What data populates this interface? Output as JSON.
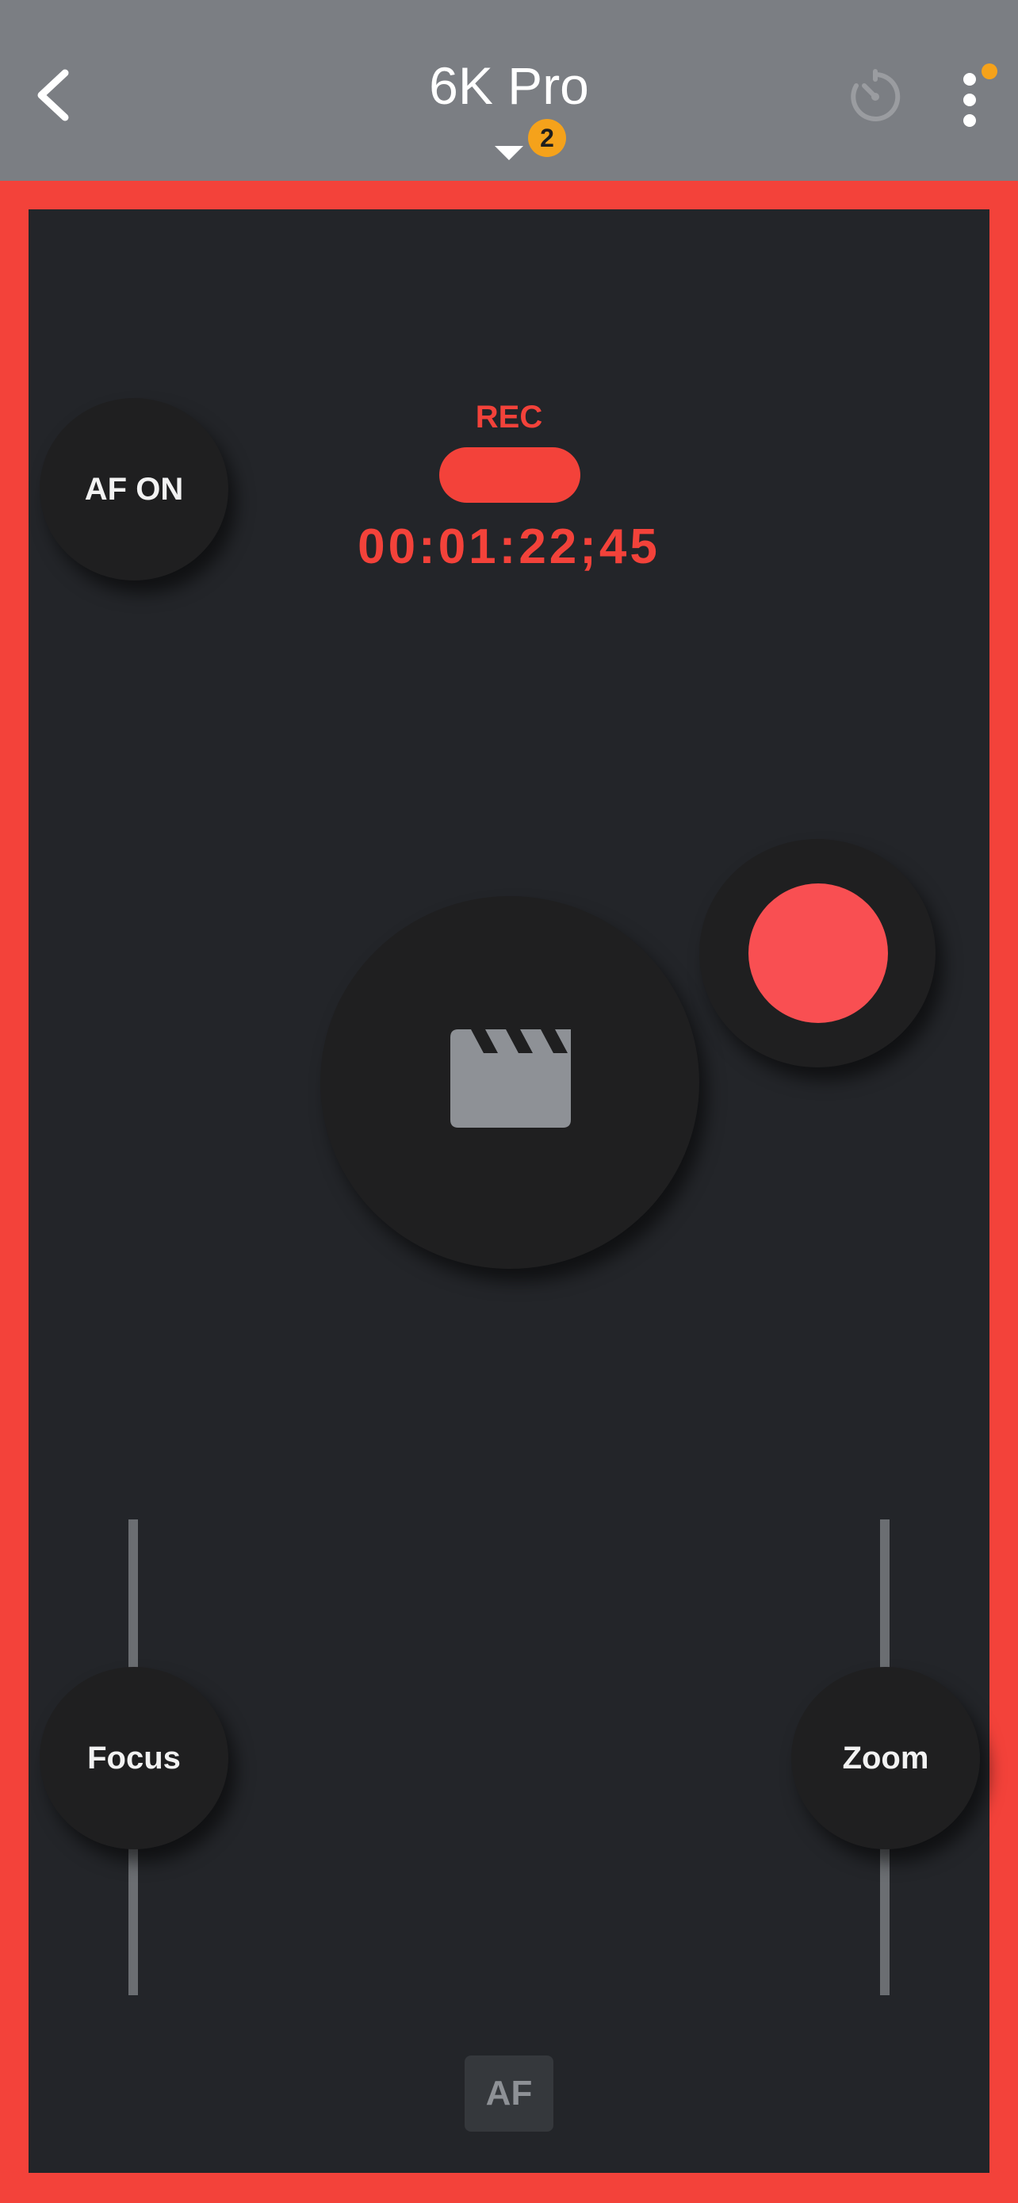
{
  "header": {
    "title": "6K Pro",
    "badge_count": "2",
    "back_icon": "chevron-left-icon",
    "timer_icon": "timer-icon",
    "more_icon": "more-vertical-icon",
    "header_color": "#7b7e83",
    "badge_color": "#f5a21b"
  },
  "controls": {
    "af_on_label": "AF ON",
    "rec_label": "REC",
    "timecode": "00:01:22;45",
    "focus_label": "Focus",
    "zoom_label": "Zoom",
    "af_label": "AF",
    "clapper_icon": "clapperboard-icon",
    "record_icon": "record-dot-icon"
  },
  "colors": {
    "recording_accent": "#f3423a",
    "record_button": "#f94f52",
    "panel_background": "#232529"
  }
}
